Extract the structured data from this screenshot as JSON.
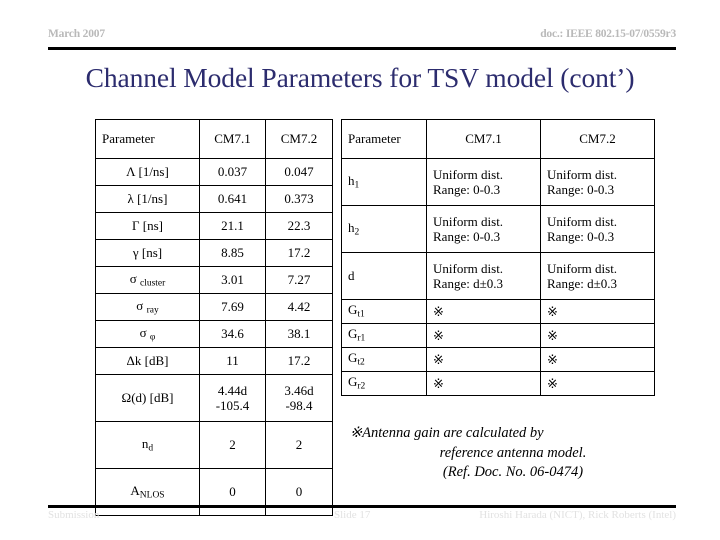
{
  "header": {
    "date": "March 2007",
    "doc": "doc.: IEEE 802.15-07/0559r3"
  },
  "title": "Channel Model Parameters for TSV model (cont’)",
  "table_left": {
    "columns": [
      "Parameter",
      "CM7.1",
      "CM7.2"
    ],
    "rows": [
      {
        "param": "Λ [1/ns]",
        "cm71": "0.037",
        "cm72": "0.047"
      },
      {
        "param": "λ [1/ns]",
        "cm71": "0.641",
        "cm72": "0.373"
      },
      {
        "param": "Γ [ns]",
        "cm71": "21.1",
        "cm72": "22.3"
      },
      {
        "param": "γ [ns]",
        "cm71": "8.85",
        "cm72": "17.2"
      },
      {
        "param_sym": "σ",
        "param_sub": "cluster",
        "cm71": "3.01",
        "cm72": "7.27"
      },
      {
        "param_sym": "σ",
        "param_sub": "ray",
        "cm71": "7.69",
        "cm72": "4.42"
      },
      {
        "param_sym": "σ",
        "param_sub": "φ",
        "cm71": "34.6",
        "cm72": "38.1"
      },
      {
        "param": "Δk [dB]",
        "cm71": "11",
        "cm72": "17.2"
      },
      {
        "param": "Ω(d) [dB]",
        "cm71_l1": "4.44d",
        "cm71_l2": "-105.4",
        "cm72_l1": "3.46d",
        "cm72_l2": "-98.4"
      },
      {
        "param_sym": "n",
        "param_sub": "d",
        "cm71": "2",
        "cm72": "2"
      },
      {
        "param_sym": "A",
        "param_sub": "NLOS",
        "cm71": "0",
        "cm72": "0"
      }
    ]
  },
  "table_right": {
    "columns": [
      "Parameter",
      "CM7.1",
      "CM7.2"
    ],
    "rows": [
      {
        "param_sym": "h",
        "param_sub": "1",
        "cm71_l1": "Uniform dist.",
        "cm71_l2": "Range: 0-0.3",
        "cm72_l1": "Uniform dist.",
        "cm72_l2": "Range: 0-0.3"
      },
      {
        "param_sym": "h",
        "param_sub": "2",
        "cm71_l1": "Uniform dist.",
        "cm71_l2": "Range: 0-0.3",
        "cm72_l1": "Uniform dist.",
        "cm72_l2": "Range: 0-0.3"
      },
      {
        "param": "d",
        "cm71_l1": "Uniform dist.",
        "cm71_l2": "Range: d±0.3",
        "cm72_l1": "Uniform dist.",
        "cm72_l2": "Range: d±0.3"
      },
      {
        "param_sym": "G",
        "param_sub": "t1",
        "cm71": "※",
        "cm72": "※"
      },
      {
        "param_sym": "G",
        "param_sub": "r1",
        "cm71": "※",
        "cm72": "※"
      },
      {
        "param_sym": "G",
        "param_sub": "t2",
        "cm71": "※",
        "cm72": "※"
      },
      {
        "param_sym": "G",
        "param_sub": "r2",
        "cm71": "※",
        "cm72": "※"
      }
    ]
  },
  "footnote": {
    "line1": "※Antenna gain are calculated by",
    "line2": "reference antenna model.",
    "line3": "(Ref. Doc. No. 06-0474)"
  },
  "footer": {
    "left": "Submission",
    "center": "Slide 17",
    "right": "Hiroshi Harada (NICT), Rick Roberts (Intel)"
  },
  "colors": {
    "title": "#2c2c6e",
    "header_text": "#b9b9b9",
    "footer_text": "#e2e2e2",
    "rule": "#000000"
  }
}
